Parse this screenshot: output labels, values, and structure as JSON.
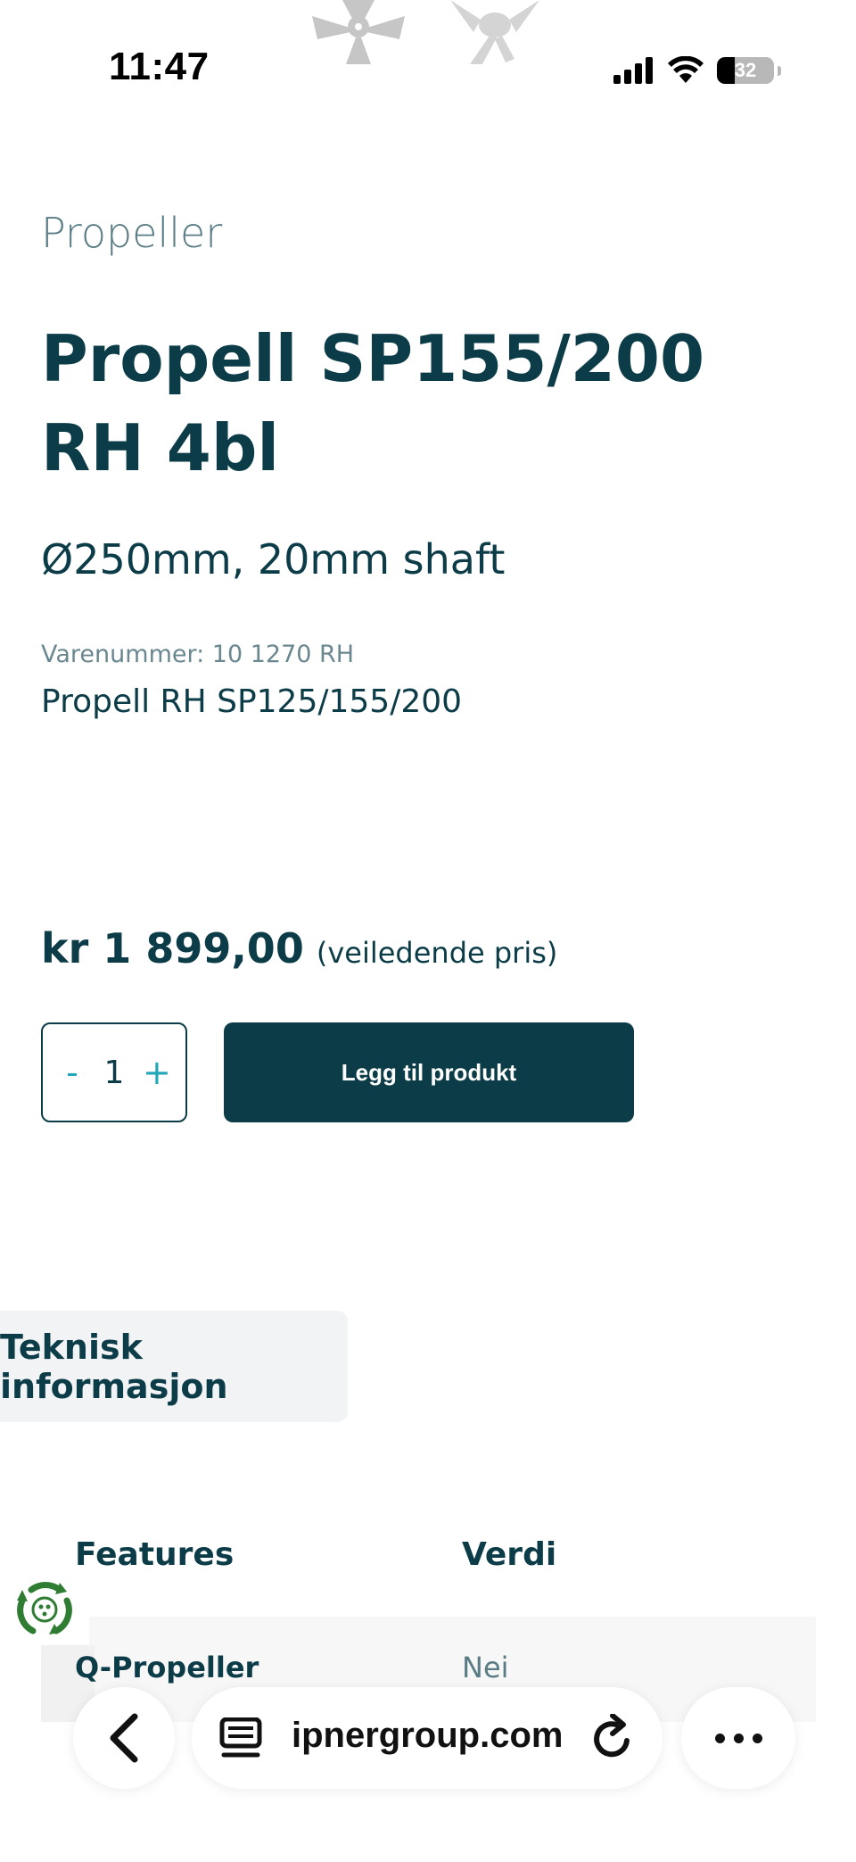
{
  "status_bar": {
    "time": "11:47",
    "battery_percent": "32",
    "icons": [
      "cellular-signal-icon",
      "wifi-icon",
      "battery-icon"
    ]
  },
  "product": {
    "category": "Propeller",
    "title": "Propell SP155/200 RH 4bl",
    "subtitle": "Ø250mm, 20mm shaft",
    "sku": "Varenummer: 10 1270 RH",
    "short_description": "Propell RH SP125/155/200",
    "price": "kr 1 899,00",
    "price_note": "(veiledende pris)",
    "quantity": "1",
    "decrement_label": "-",
    "increment_label": "+",
    "add_button_label": "Legg til produkt"
  },
  "tabs": {
    "technical_info": "Teknisk informasjon"
  },
  "spec_table": {
    "headers": [
      "Features",
      "Verdi"
    ],
    "rows": [
      [
        "Q-Propeller",
        "Nei"
      ]
    ]
  },
  "browser": {
    "url": "ipnergroup.com",
    "icons": [
      "back-arrow-icon",
      "tabs-icon",
      "reload-icon",
      "more-icon"
    ]
  },
  "colors": {
    "primary": "#0b3c47",
    "accent": "#21a6b8",
    "muted": "#5a7c84",
    "tab_bg": "#f1f3f5"
  }
}
